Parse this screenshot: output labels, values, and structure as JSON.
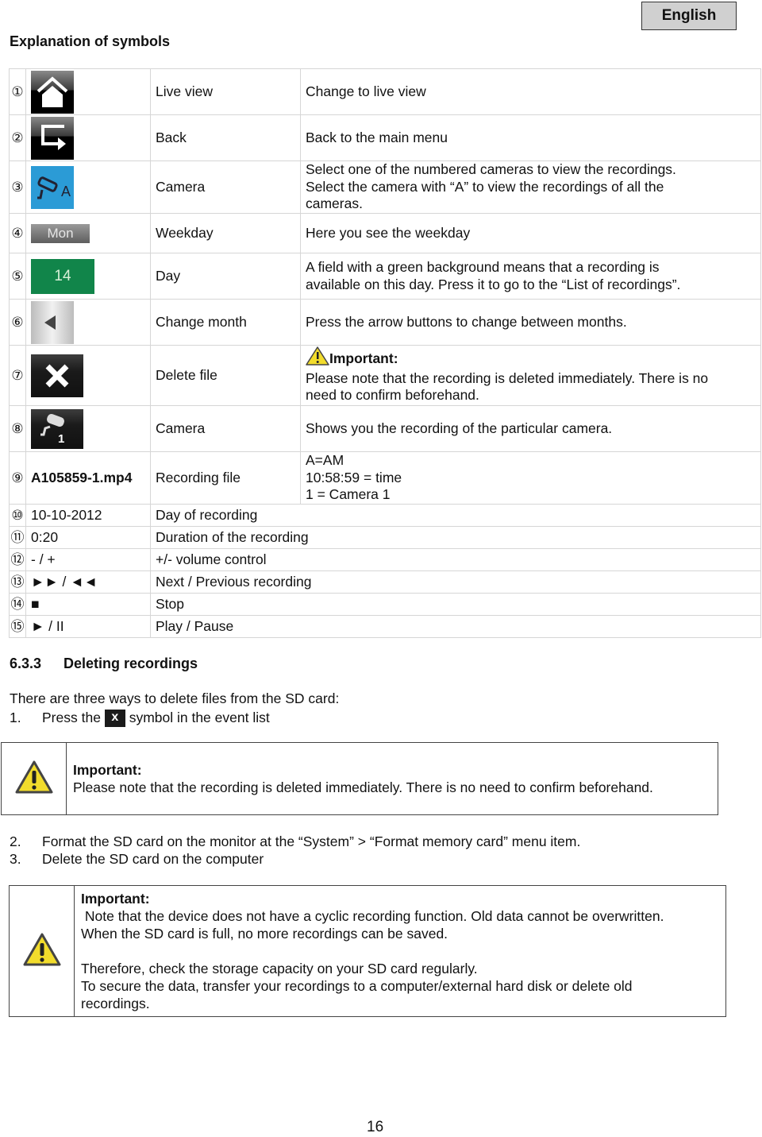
{
  "header": {
    "language": "English",
    "title": "Explanation of symbols"
  },
  "symbols": [
    {
      "num": "①",
      "icon": "home-icon",
      "name": "Live view",
      "desc": [
        "Change to live view"
      ]
    },
    {
      "num": "②",
      "icon": "back-arrow-icon",
      "name": "Back",
      "desc": [
        "Back to the main menu"
      ]
    },
    {
      "num": "③",
      "icon": "camera-all-icon",
      "icon_text": "A",
      "name": "Camera",
      "desc": [
        "Select one of the numbered cameras to view the recordings.",
        "Select the camera with “A” to view the recordings of all the",
        "cameras."
      ]
    },
    {
      "num": "④",
      "icon": "weekday-button",
      "icon_text": "Mon",
      "name": "Weekday",
      "desc": [
        "Here you see the weekday"
      ]
    },
    {
      "num": "⑤",
      "icon": "day-button",
      "icon_text": "14",
      "name": "Day",
      "desc": [
        "A field with a green background means that a recording is",
        "available on this day. Press it to go to the “List of recordings”."
      ]
    },
    {
      "num": "⑥",
      "icon": "left-arrow-icon",
      "name": "Change month",
      "desc": [
        "Press the arrow buttons to change between months."
      ]
    },
    {
      "num": "⑦",
      "icon": "close-icon",
      "name": "Delete file",
      "important": "Important:",
      "desc": [
        "Please note that the recording is deleted immediately. There is no",
        "need to confirm beforehand."
      ]
    },
    {
      "num": "⑧",
      "icon": "camera-1-icon",
      "icon_text": "1",
      "name": "Camera",
      "desc": [
        "Shows you the recording of the particular camera."
      ]
    },
    {
      "num": "⑨",
      "value": "A105859-1.mp4",
      "name": "Recording file",
      "desc": [
        "A=AM",
        "10:58:59 = time",
        "1 = Camera 1"
      ]
    },
    {
      "num": "⑩",
      "value": "10-10-2012",
      "name": "Day of recording"
    },
    {
      "num": "⑪",
      "value": "0:20",
      "name": "Duration of the recording"
    },
    {
      "num": "⑫",
      "value": "- / +",
      "name": "+/- volume control"
    },
    {
      "num": "⑬",
      "value": "►► / ◄◄",
      "name": "Next / Previous recording"
    },
    {
      "num": "⑭",
      "value": "■",
      "name": "Stop"
    },
    {
      "num": "⑮",
      "value": "► / II",
      "name": "Play / Pause"
    }
  ],
  "section": {
    "number": "6.3.3",
    "title": "Deleting recordings",
    "intro": "There are three ways to delete files from the SD card:",
    "steps": [
      {
        "num": "1.",
        "before": "Press the",
        "icon_text": "x",
        "after": "symbol in the event list"
      },
      {
        "num": "2.",
        "text": "Format the SD card on the monitor at the “System” > “Format memory card” menu item."
      },
      {
        "num": "3.",
        "text": "Delete the SD card on the computer"
      }
    ],
    "note1": {
      "title": "Important:",
      "lines": [
        "Please note that the recording is deleted immediately. There is no need to confirm beforehand."
      ]
    },
    "note2": {
      "title": "Important:",
      "lines": [
        " Note that the device does not have a cyclic recording function. Old data cannot be overwritten.",
        "When the SD card is full, no more recordings can be saved.",
        "",
        "Therefore, check the storage capacity on your SD card regularly.",
        "To secure the data, transfer your recordings to a computer/external hard disk or delete old",
        "recordings."
      ]
    }
  },
  "footer": {
    "page_number": "16"
  },
  "colors": {
    "day_green": "#11854a",
    "camera_blue": "#2b9bd6",
    "warning_yellow": "#f2dc2c"
  }
}
